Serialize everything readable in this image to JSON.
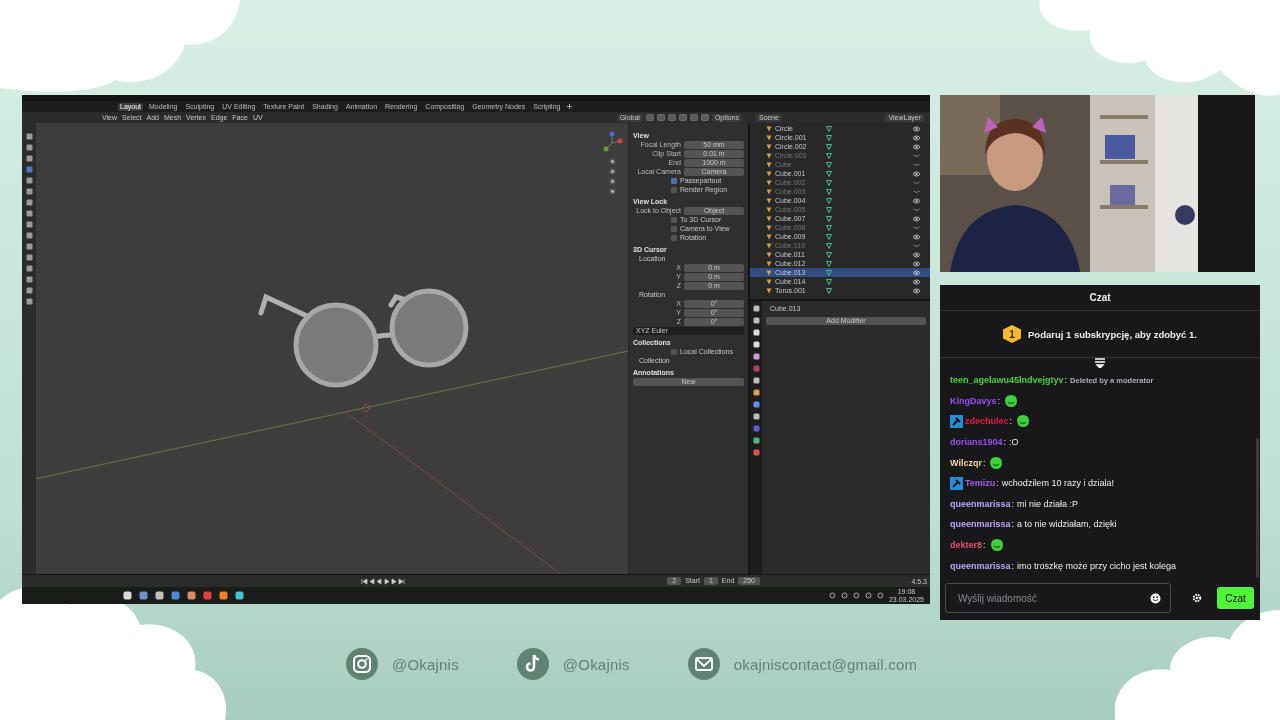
{
  "blender": {
    "workspaces": [
      {
        "label": "Layout",
        "selected": true
      },
      {
        "label": "Modeling",
        "selected": false
      },
      {
        "label": "Sculpting",
        "selected": false
      },
      {
        "label": "UV Editing",
        "selected": false
      },
      {
        "label": "Texture Paint",
        "selected": false
      },
      {
        "label": "Shading",
        "selected": false
      },
      {
        "label": "Animation",
        "selected": false
      },
      {
        "label": "Rendering",
        "selected": false
      },
      {
        "label": "Compositing",
        "selected": false
      },
      {
        "label": "Geometry Nodes",
        "selected": false
      },
      {
        "label": "Scripting",
        "selected": false
      }
    ],
    "menu": [
      "View",
      "Select",
      "Add",
      "Mesh",
      "Vertex",
      "Edge",
      "Face",
      "UV"
    ],
    "transform": "Global",
    "options": "Options",
    "n_panel": [
      {
        "kind": "section",
        "label": "View"
      },
      {
        "kind": "field",
        "label": "Focal Length",
        "value": "50 mm"
      },
      {
        "kind": "field",
        "label": "Clip Start",
        "value": "0.01 m"
      },
      {
        "kind": "field",
        "label": "End",
        "value": "1000 m"
      },
      {
        "kind": "field",
        "label": "Local Camera",
        "value": "Camera"
      },
      {
        "kind": "checkbox",
        "label": "Passepartout",
        "checked": true
      },
      {
        "kind": "checkbox",
        "label": "Render Region",
        "checked": false
      },
      {
        "kind": "section",
        "label": "View Lock"
      },
      {
        "kind": "field",
        "label": "Lock to Object",
        "value": "Object"
      },
      {
        "kind": "checkbox",
        "label": "To 3D Cursor",
        "checked": false
      },
      {
        "kind": "checkbox",
        "label": "Camera to View",
        "checked": false
      },
      {
        "kind": "checkbox",
        "label": "Rotation",
        "checked": false
      },
      {
        "kind": "section",
        "label": "3D Cursor"
      },
      {
        "kind": "label",
        "label": "Location"
      },
      {
        "kind": "field",
        "label": "X",
        "value": "0 m"
      },
      {
        "kind": "field",
        "label": "Y",
        "value": "0 m"
      },
      {
        "kind": "field",
        "label": "Z",
        "value": "0 m"
      },
      {
        "kind": "label",
        "label": "Rotation"
      },
      {
        "kind": "field",
        "label": "X",
        "value": "0°"
      },
      {
        "kind": "field",
        "label": "Y",
        "value": "0°"
      },
      {
        "kind": "field",
        "label": "Z",
        "value": "0°"
      },
      {
        "kind": "dropdown",
        "label": "XYZ Euler"
      },
      {
        "kind": "section",
        "label": "Collections"
      },
      {
        "kind": "checkbox",
        "label": "Local Collections",
        "checked": false
      },
      {
        "kind": "label",
        "label": "Collection"
      },
      {
        "kind": "section",
        "label": "Annotations"
      },
      {
        "kind": "button",
        "label": "New"
      }
    ],
    "scene": "Scene",
    "view_layer": "ViewLayer",
    "outliner": [
      {
        "name": "Circle",
        "visible": true,
        "selected": false
      },
      {
        "name": "Circle.001",
        "visible": true,
        "selected": false
      },
      {
        "name": "Circle.002",
        "visible": true,
        "selected": false
      },
      {
        "name": "Circle.003",
        "visible": false,
        "selected": false
      },
      {
        "name": "Cube",
        "visible": false,
        "selected": false
      },
      {
        "name": "Cube.001",
        "visible": true,
        "selected": false
      },
      {
        "name": "Cube.002",
        "visible": false,
        "selected": false
      },
      {
        "name": "Cube.003",
        "visible": false,
        "selected": false
      },
      {
        "name": "Cube.004",
        "visible": true,
        "selected": false
      },
      {
        "name": "Cube.005",
        "visible": false,
        "selected": false
      },
      {
        "name": "Cube.007",
        "visible": true,
        "selected": false
      },
      {
        "name": "Cube.008",
        "visible": false,
        "selected": false
      },
      {
        "name": "Cube.009",
        "visible": true,
        "selected": false
      },
      {
        "name": "Cube.010",
        "visible": false,
        "selected": false
      },
      {
        "name": "Cube.011",
        "visible": true,
        "selected": false
      },
      {
        "name": "Cube.012",
        "visible": true,
        "selected": false
      },
      {
        "name": "Cube.013",
        "visible": true,
        "selected": true
      },
      {
        "name": "Cube.014",
        "visible": true,
        "selected": false
      },
      {
        "name": "Torus.001",
        "visible": true,
        "selected": false
      }
    ],
    "modifier_object": "Cube.013",
    "add_modifier": "Add Modifier",
    "timeline": {
      "frame": "2",
      "start_label": "Start",
      "start": "1",
      "end_label": "End",
      "end": "250"
    },
    "version": "4.5.3",
    "clock": {
      "time": "19:08",
      "date": "23.03.2025"
    }
  },
  "chat": {
    "title": "Czat",
    "gift": {
      "badge": "1",
      "text": "Podaruj 1 subskrypcję, aby zdobyć 1."
    },
    "messages": [
      {
        "user": "teen_agelawu45lndvejgtyv",
        "separator": ":",
        "color": "#4ccf3c",
        "moderator": false,
        "kind": "deleted",
        "text": "Deleted by a moderator"
      },
      {
        "user": "KingDavys",
        "separator": ":",
        "color": "#9a4ff0",
        "moderator": false,
        "kind": "emote"
      },
      {
        "user": "zdechulec",
        "separator": ":",
        "color": "#e8193c",
        "moderator": true,
        "kind": "emote"
      },
      {
        "user": "dorians1904",
        "separator": ":",
        "color": "#9a4ff0",
        "moderator": false,
        "kind": "text",
        "text": ":O"
      },
      {
        "user": "Wilczqr",
        "separator": ":",
        "color": "#f2d6a0",
        "moderator": false,
        "kind": "emote"
      },
      {
        "user": "Temizu",
        "separator": ":",
        "color": "#a05ee8",
        "moderator": true,
        "kind": "text",
        "text": "wchodzilem 10 razy i dziala!"
      },
      {
        "user": "queenmarissa",
        "separator": ":",
        "color": "#bba6f6",
        "moderator": false,
        "kind": "text",
        "text": "mi nie działa :P"
      },
      {
        "user": "queenmarissa",
        "separator": ":",
        "color": "#bba6f6",
        "moderator": false,
        "kind": "text",
        "text": "a to nie widziałam, dzięki"
      },
      {
        "user": "dekter8",
        "separator": ":",
        "color": "#e34f70",
        "moderator": false,
        "kind": "emote"
      },
      {
        "user": "queenmarissa",
        "separator": ":",
        "color": "#bba6f6",
        "moderator": false,
        "kind": "text",
        "text": "imo troszkę może przy cicho jest kolega"
      }
    ],
    "input": {
      "placeholder": "Wyślij wiadomość"
    },
    "send": "Czat"
  },
  "socials": [
    {
      "kind": "instagram",
      "label": "@Okajnis"
    },
    {
      "kind": "tiktok",
      "label": "@Okajnis"
    },
    {
      "kind": "mail",
      "label": "okajniscontact@gmail.com"
    }
  ]
}
